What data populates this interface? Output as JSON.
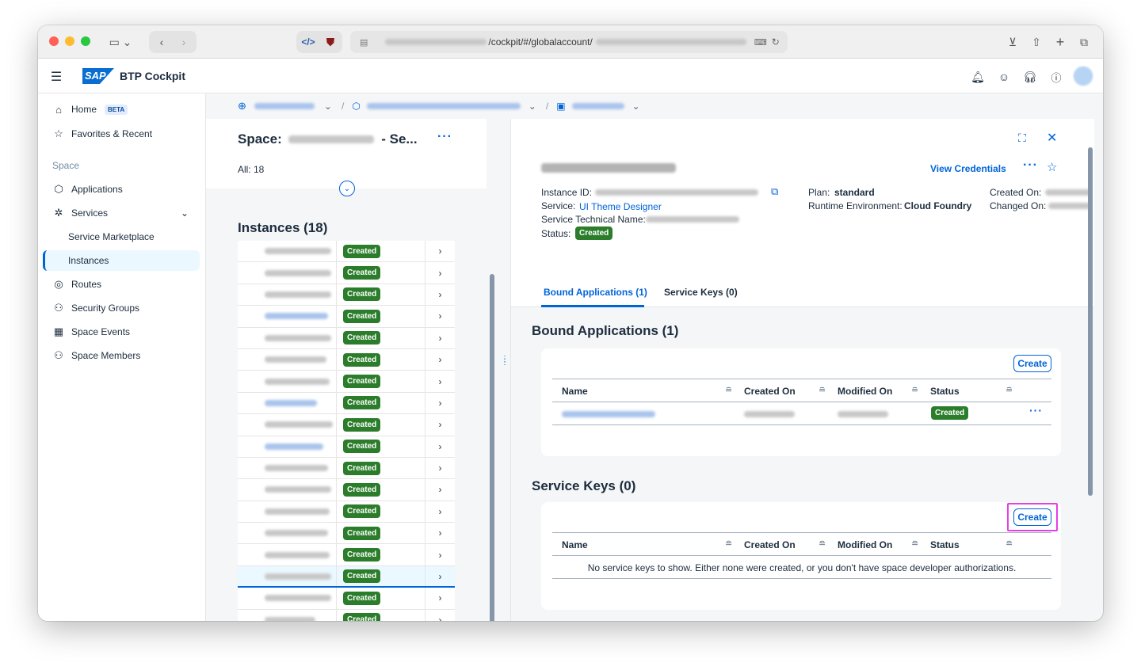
{
  "browser": {
    "url_visible": "/cockpit/#/globalaccount/"
  },
  "shell": {
    "logo_text": "SAP",
    "title": "BTP Cockpit"
  },
  "sidenav": {
    "home": "Home",
    "home_badge": "BETA",
    "favorites": "Favorites & Recent",
    "group_label": "Space",
    "items": [
      {
        "label": "Applications"
      },
      {
        "label": "Services"
      },
      {
        "label": "Service Marketplace"
      },
      {
        "label": "Instances"
      },
      {
        "label": "Routes"
      },
      {
        "label": "Security Groups"
      },
      {
        "label": "Space Events"
      },
      {
        "label": "Space Members"
      }
    ]
  },
  "list": {
    "title_prefix": "Space:",
    "title_suffix": "- Se...",
    "all_count": "All: 18",
    "instances_title": "Instances (18)",
    "status_label": "Created",
    "row_count": 18,
    "selected_row": 15
  },
  "detail": {
    "view_credentials": "View Credentials",
    "instance_id_label": "Instance ID:",
    "service_label": "Service:",
    "service_value": "UI Theme Designer",
    "technical_name_label": "Service Technical Name:",
    "status_label": "Status:",
    "status_value": "Created",
    "plan_label": "Plan:",
    "plan_value": "standard",
    "runtime_label": "Runtime Environment:",
    "runtime_value": "Cloud Foundry",
    "created_on_label": "Created On:",
    "changed_on_label": "Changed On:",
    "tabs": [
      {
        "label": "Bound Applications (1)"
      },
      {
        "label": "Service Keys (0)"
      }
    ]
  },
  "bound_apps": {
    "title": "Bound Applications (1)",
    "create": "Create",
    "columns": [
      "Name",
      "Created On",
      "Modified On",
      "Status"
    ],
    "row_status": "Created"
  },
  "service_keys": {
    "title": "Service Keys (0)",
    "create": "Create",
    "columns": [
      "Name",
      "Created On",
      "Modified On",
      "Status"
    ],
    "empty_text": "No service keys to show. Either none were created, or you don't have space developer authorizations."
  }
}
